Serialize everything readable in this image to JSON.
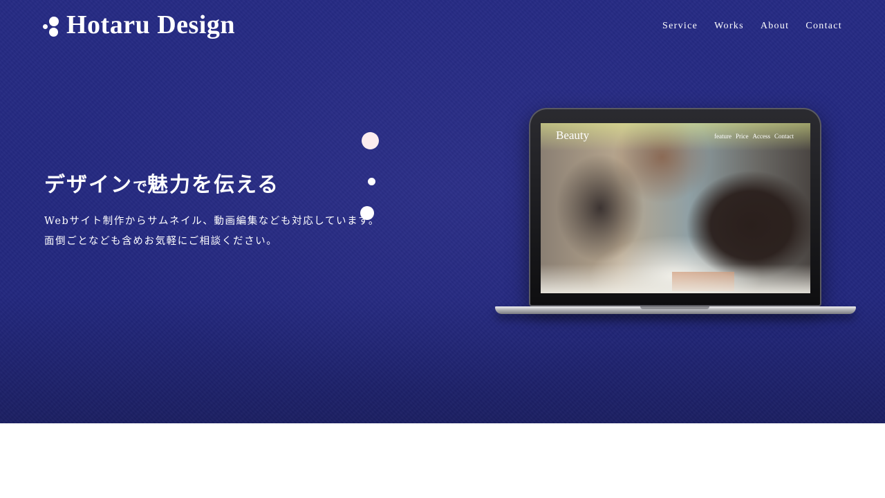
{
  "logo": {
    "text": "Hotaru Design",
    "icon": "firefly-dots-icon"
  },
  "nav": {
    "items": [
      "Service",
      "Works",
      "About",
      "Contact"
    ]
  },
  "hero": {
    "headline_main": "デザイン",
    "headline_small": "で",
    "headline_tail": "魅力を伝える",
    "description_line1": "Webサイト制作からサムネイル、動画編集なども対応しています。",
    "description_line2": "面倒ごとなども含めお気軽にご相談ください。"
  },
  "laptop_screen": {
    "title": "Beauty",
    "nav": [
      "feature",
      "Price",
      "Access",
      "Contact"
    ]
  },
  "colors": {
    "hero_bg": "#262b84",
    "text": "#ffffff",
    "accent_dot": "#fcecef"
  }
}
